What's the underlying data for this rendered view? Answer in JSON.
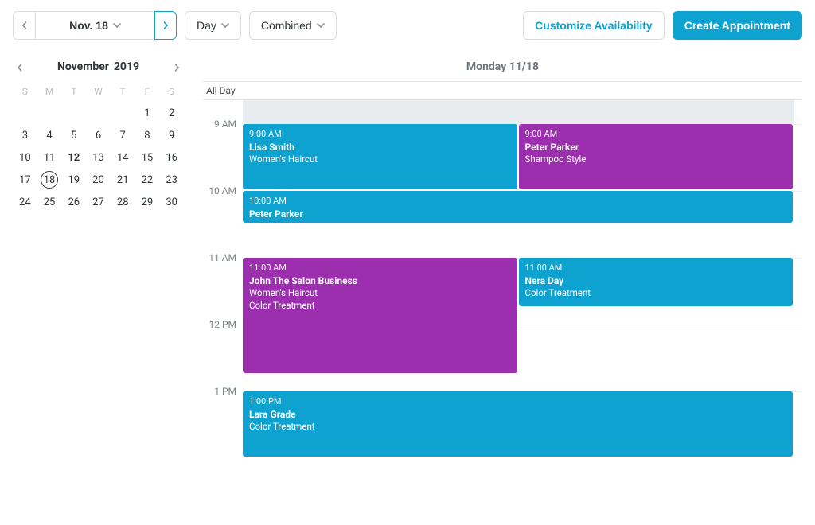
{
  "colors": {
    "primary": "#0ea2d1",
    "purple": "#9b2fae",
    "band": "#e9ecef"
  },
  "toolbar": {
    "date_label": "Nov. 18",
    "view_label": "Day",
    "mode_label": "Combined",
    "customize_label": "Customize Availability",
    "create_label": "Create Appointment"
  },
  "miniCalendar": {
    "month_label": "November",
    "year_label": "2019",
    "dow": [
      "S",
      "M",
      "T",
      "W",
      "T",
      "F",
      "S"
    ],
    "first_weekday": 5,
    "days_in_month": 30,
    "selected_day": 18,
    "bold_days": [
      12
    ]
  },
  "schedule": {
    "heading": "Monday 11/18",
    "all_day_label": "All Day",
    "hours": [
      "9 AM",
      "10 AM",
      "11 AM",
      "12 PM",
      "1 PM"
    ],
    "pxPerHour": 84,
    "topPad": 30,
    "band": {
      "startHour": 8.55,
      "endHour": 9
    },
    "appointments": [
      {
        "time": "9:00 AM",
        "name": "Lisa Smith",
        "services": [
          "Women's Haircut"
        ],
        "color": "blue",
        "col": 0,
        "cols": 2,
        "startHour": 9,
        "endHour": 10
      },
      {
        "time": "9:00 AM",
        "name": "Peter Parker",
        "services": [
          "Shampoo Style"
        ],
        "color": "purple",
        "col": 1,
        "cols": 2,
        "startHour": 9,
        "endHour": 10
      },
      {
        "time": "10:00 AM",
        "name": "Peter Parker",
        "services": [],
        "color": "blue",
        "col": 0,
        "cols": 1,
        "startHour": 10,
        "endHour": 10.5
      },
      {
        "time": "11:00 AM",
        "name": "John The Salon Business",
        "services": [
          "Women's Haircut",
          "Color Treatment"
        ],
        "color": "purple",
        "col": 0,
        "cols": 2,
        "startHour": 11,
        "endHour": 12.75
      },
      {
        "time": "11:00 AM",
        "name": "Nera Day",
        "services": [
          "Color Treatment"
        ],
        "color": "blue",
        "col": 1,
        "cols": 2,
        "startHour": 11,
        "endHour": 11.75
      },
      {
        "time": "1:00 PM",
        "name": "Lara Grade",
        "services": [
          "Color Treatment"
        ],
        "color": "blue",
        "col": 0,
        "cols": 1,
        "startHour": 13,
        "endHour": 14
      }
    ]
  }
}
